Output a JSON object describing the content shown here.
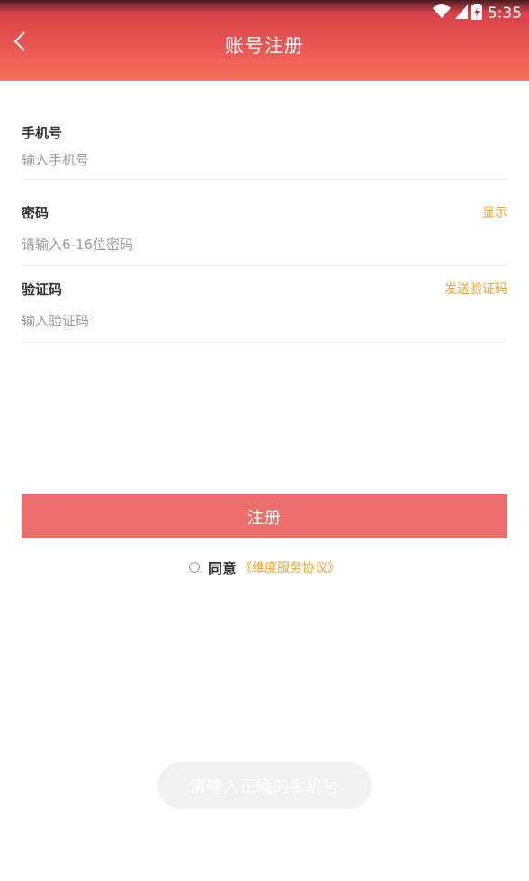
{
  "status_bar": {
    "time": "5:35",
    "icons": [
      "wifi-icon",
      "signal-icon",
      "battery-charging-icon"
    ]
  },
  "header": {
    "title": "账号注册",
    "back_icon": "chevron-left-icon"
  },
  "form": {
    "phone": {
      "label": "手机号",
      "placeholder": "输入手机号",
      "value": ""
    },
    "password": {
      "label": "密码",
      "placeholder": "请输入6-16位密码",
      "value": "",
      "toggle_label": "显示"
    },
    "code": {
      "label": "验证码",
      "placeholder": "输入验证码",
      "value": "",
      "send_label": "发送验证码"
    }
  },
  "submit": {
    "label": "注册"
  },
  "agreement": {
    "text": "同意",
    "link": "《维度服务协议》",
    "checked": false
  },
  "toast": {
    "message": "请输入正确的手机号"
  },
  "colors": {
    "header_top": "#d8414a",
    "header_bottom": "#f4715a",
    "accent": "#f0a23a",
    "button": "#ec6e6a"
  }
}
